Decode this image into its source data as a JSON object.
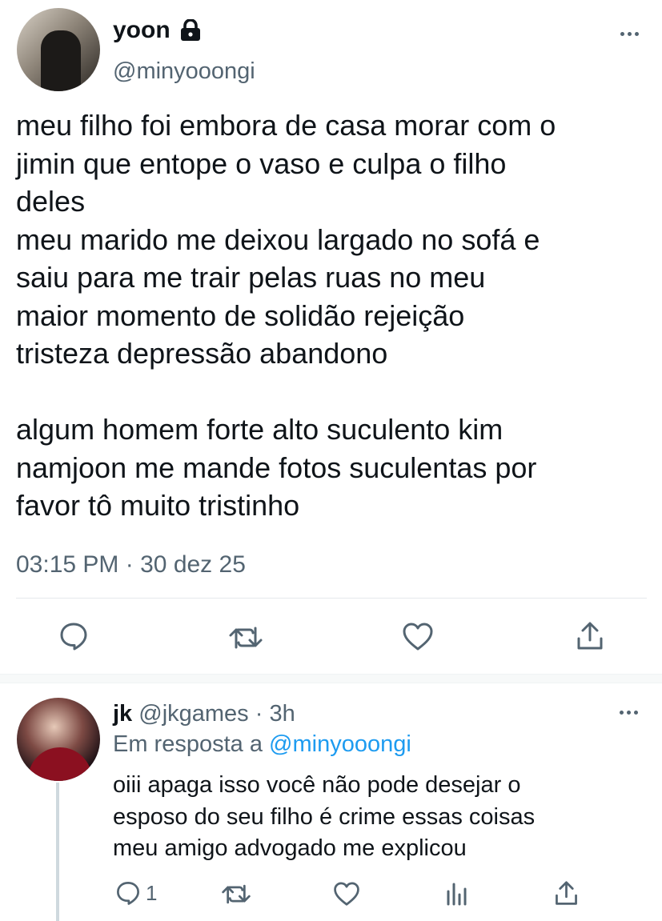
{
  "main_tweet": {
    "display_name": "yoon",
    "handle": "@minyooongi",
    "text": "meu filho foi embora de casa morar com o\njimin que entope o vaso e culpa o filho\ndeles\nmeu marido me deixou largado no sofá e\nsaiu para me trair pelas ruas no meu\nmaior momento de solidão rejeição\ntristeza depressão abandono\n\nalgum homem forte alto suculento kim\nnamjoon me mande fotos suculentas por\nfavor tô muito tristinho",
    "time": "03:15 PM",
    "date": "30 dez 25",
    "dot": "·",
    "icons": [
      "lock-icon",
      "more-icon",
      "reply-icon",
      "retweet-icon",
      "like-icon",
      "share-icon"
    ]
  },
  "reply": {
    "display_name": "jk",
    "handle": "@jkgames",
    "dot": "·",
    "age": "3h",
    "replying_prefix": "Em resposta a",
    "replying_handle": "@minyooongi",
    "text": "oiii apaga isso você não pode desejar o\nesposo do seu filho é crime essas coisas\nmeu amigo advogado me explicou",
    "reply_count": "1",
    "icons": [
      "more-icon",
      "reply-icon",
      "retweet-icon",
      "like-icon",
      "analytics-icon",
      "share-icon"
    ]
  },
  "colors": {
    "text": "#0f1419",
    "muted": "#536471",
    "link": "#1d9bf0",
    "divider": "#e6e9ec"
  }
}
